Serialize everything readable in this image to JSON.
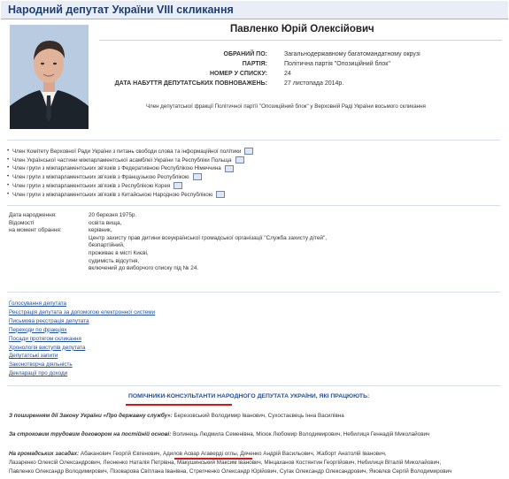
{
  "header": {
    "title": "Народний депутат України VIII скликання"
  },
  "deputy": {
    "name": "Павленко Юрій Олексійович",
    "fields": [
      {
        "label": "ОБРАНИЙ ПО:",
        "value": "Загальнодержавному багатомандатному окрузі"
      },
      {
        "label": "ПАРТІЯ:",
        "value": "Політична партія \"Опозиційний блок\""
      },
      {
        "label": "НОМЕР У СПИСКУ:",
        "value": "24"
      },
      {
        "label": "ДАТА НАБУТТЯ ДЕПУТАТСЬКИХ ПОВНОВАЖЕНЬ:",
        "value": "27 листопада 2014р."
      }
    ],
    "faction": "Член депутатської фракції Політичної партії \"Опозиційний блок\" у Верховній Раді України восьмого скликання"
  },
  "memberships": [
    "Член Комітету Верховної Ради України з питань свободи слова та інформаційної політики",
    "Член Української частини міжпарламентської асамблеї України та Республіки Польща",
    "Член групи з міжпарламентських зв'язків з Федеративною Республікою Німеччина",
    "Член групи з міжпарламентських зв'язків з Французькою Республікою",
    "Член групи з міжпарламентських зв'язків з Республікою Корея",
    "Член групи з міжпарламентських зв'язків з Китайською Народною Республікою"
  ],
  "bio": {
    "labels": [
      "Дата народження:",
      "Відомості",
      "на момент обрання:"
    ],
    "values": [
      "20 березня 1975р.",
      "освіта вища,",
      "керівник,",
      "Центр захисту прав дитини всеукраїнської громадської організації \"Служба захисту дітей\",",
      "безпартійний,",
      "проживає в місті Києві,",
      "судимість відсутня,",
      "включений до виборчого списку під № 24."
    ]
  },
  "links": [
    "Голосування депутата",
    "Реєстрація депутата за допомогою електронної системи",
    "Письмова реєстрація депутата",
    "Переходи по фракціях",
    "Посади протягом скликання",
    "Хронологія виступів депутата",
    "Депутатські запити",
    "Законотворча діяльність",
    "Декларації про доходи"
  ],
  "assistants": {
    "title": "ПОМІЧНИКИ-КОНСУЛЬТАНТИ НАРОДНОГО ДЕПУТАТА УКРАЇНИ, ЯКІ ПРАЦЮЮТЬ:",
    "state_label": "З поширенням дії Закону України «Про державну службу»:",
    "state_names": "Березовський Володимир Іванович, Сухостаєвець Інна Василівна",
    "contract_label": "За строковим трудовим договором на постійній основі:",
    "contract_names": "Волинець Людмила Семенівна, Місюк Любомир Володимирович, Небилиця Геннадій Миколайович",
    "volunteer_label": "На громадських засадах:",
    "volunteer_line1": "Абаканович Георгій Євгенович, Адилов Асвар Агаверді оглы, Дяченко Андрій Васильович, Жаборт Анатолій Іванович,",
    "volunteer_line2": "Лазаренко Олексій Олександрович, Леоненко Наталія Петрівна, Макушинський Максим Іванович, Мінцаханов Костянтин Георгійович, Небилиця Віталій Миколайович,",
    "volunteer_line3": "Павленко Олександр Володимирович, Пізоварова Світлана Іванівна, Стрепченко Олександр Юрійович, Сугак Олександр Олександрович, Яковлєв Сергій Володимирович"
  }
}
